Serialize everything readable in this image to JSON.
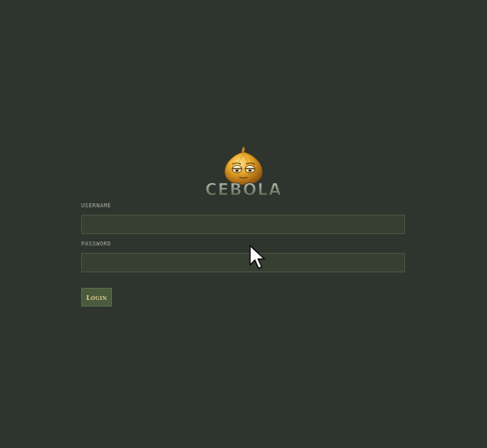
{
  "logo": {
    "brand_text": "CEBOLA",
    "mascot_icon": "onion-face-icon"
  },
  "form": {
    "username_label": "USERNAME",
    "username_value": "",
    "password_label": "PASSWORD",
    "password_value": "",
    "login_button_label": "Login"
  },
  "colors": {
    "background": "#2e342e",
    "input_background": "#373f33",
    "button_background": "#4a5a3c",
    "button_text": "#d6c98a",
    "label_text": "#a7ab9f"
  }
}
